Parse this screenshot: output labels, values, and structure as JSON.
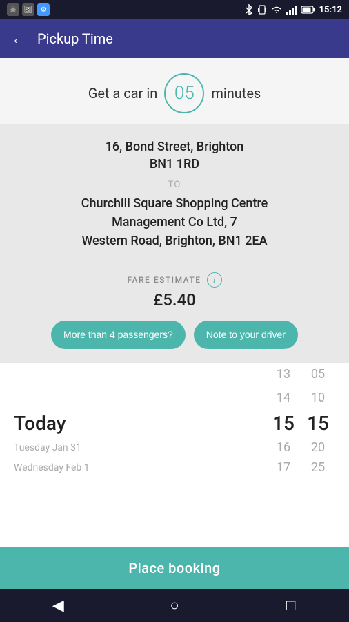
{
  "statusBar": {
    "icons": [
      "skull",
      "photo",
      "settings"
    ],
    "rightIcons": [
      "bluetooth",
      "vibrate",
      "wifi",
      "signal",
      "battery"
    ],
    "time": "15:12"
  },
  "navBar": {
    "title": "Pickup Time",
    "backLabel": "←"
  },
  "getCarSection": {
    "prefix": "Get a car in",
    "minutes": "05",
    "suffix": "minutes"
  },
  "addressCard": {
    "fromLine1": "16, Bond Street, Brighton",
    "fromLine2": "BN1 1RD",
    "toLabel": "TO",
    "toLine1": "Churchill Square Shopping Centre",
    "toLine2": "Management Co Ltd, 7",
    "toLine3": "Western Road, Brighton, BN1 2EA"
  },
  "fareSection": {
    "label": "FARE ESTIMATE",
    "infoIcon": "i",
    "amount": "£5.40"
  },
  "buttons": {
    "passengers": "More than 4 passengers?",
    "note": "Note to your driver"
  },
  "picker": {
    "col1Label": "13",
    "col2Label": "05",
    "rows": [
      {
        "day": "",
        "num1": "13",
        "num2": "05",
        "isHeader": true
      },
      {
        "day": "",
        "num1": "14",
        "num2": "10"
      },
      {
        "day": "Today",
        "num1": "15",
        "num2": "15",
        "isToday": true
      },
      {
        "dateLabel": "Tuesday Jan 31",
        "num1": "16",
        "num2": "20"
      },
      {
        "dateLabel": "Wednesday Feb 1",
        "num1": "17",
        "num2": "25"
      }
    ]
  },
  "bookingBar": {
    "label": "Place booking"
  },
  "bottomNav": {
    "back": "◀",
    "home": "○",
    "recent": "□"
  }
}
